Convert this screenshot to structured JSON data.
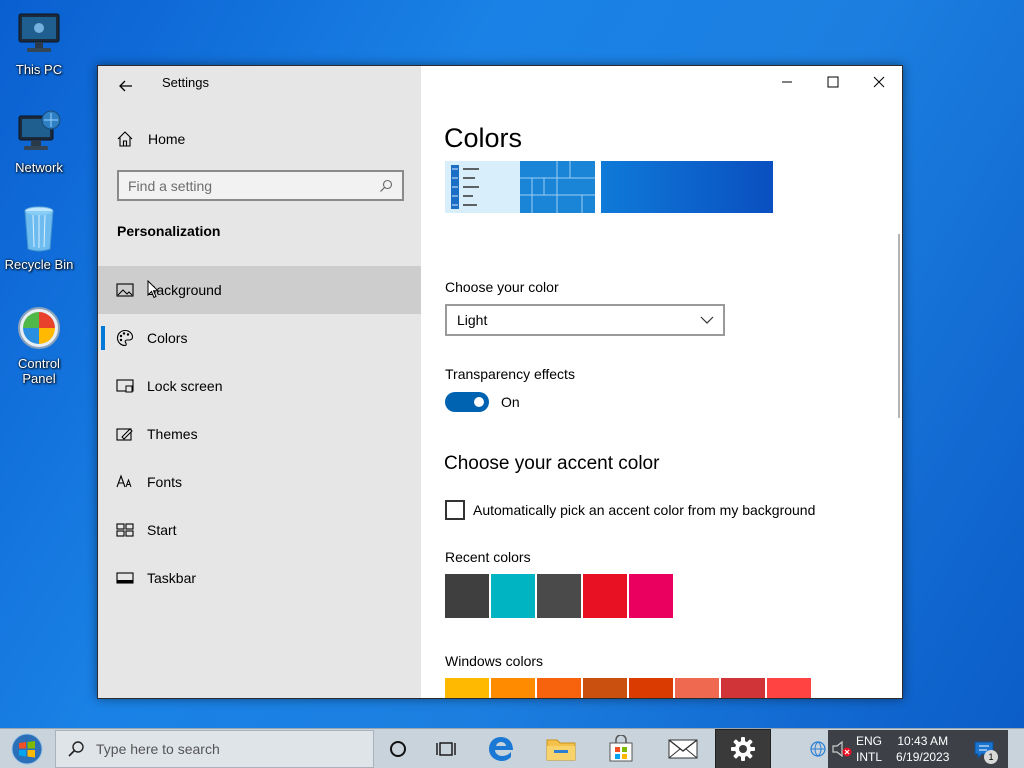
{
  "desktop": {
    "icons": [
      {
        "label": "This PC"
      },
      {
        "label": "Network"
      },
      {
        "label": "Recycle Bin"
      },
      {
        "label": "Control Panel"
      }
    ]
  },
  "window": {
    "app_title": "Settings",
    "sidebar": {
      "home_label": "Home",
      "search_placeholder": "Find a setting",
      "section_title": "Personalization",
      "items": [
        {
          "label": "Background",
          "icon": "picture-icon",
          "hover": true
        },
        {
          "label": "Colors",
          "icon": "palette-icon",
          "selected": true
        },
        {
          "label": "Lock screen",
          "icon": "lock-screen-icon"
        },
        {
          "label": "Themes",
          "icon": "brush-icon"
        },
        {
          "label": "Fonts",
          "icon": "font-icon"
        },
        {
          "label": "Start",
          "icon": "start-layout-icon"
        },
        {
          "label": "Taskbar",
          "icon": "taskbar-icon"
        }
      ]
    },
    "main": {
      "title": "Colors",
      "choose_color_label": "Choose your color",
      "choose_color_value": "Light",
      "transparency_label": "Transparency effects",
      "transparency_state": "On",
      "accent_heading": "Choose your accent color",
      "auto_pick_label": "Automatically pick an accent color from my background",
      "recent_colors_label": "Recent colors",
      "recent_colors": [
        "#3f3f3f",
        "#00b4c2",
        "#4a4a4a",
        "#e81123",
        "#ea005e"
      ],
      "windows_colors_label": "Windows colors",
      "windows_colors": [
        "#ffb900",
        "#ff8c00",
        "#f7630c",
        "#ca5010",
        "#da3b01",
        "#ef6950",
        "#d13438",
        "#ff4343"
      ]
    }
  },
  "taskbar": {
    "search_placeholder": "Type here to search",
    "lang_top": "ENG",
    "lang_bottom": "INTL",
    "time": "10:43 AM",
    "date": "6/19/2023",
    "notification_count": "1"
  },
  "colors": {
    "accent": "#0078d7",
    "toggle_on": "#0063b1"
  }
}
